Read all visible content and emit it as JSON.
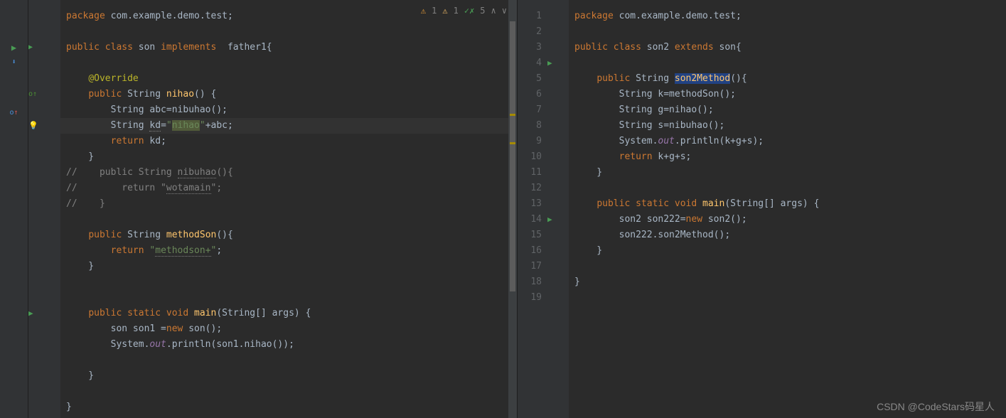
{
  "inspector": {
    "warn": "1",
    "weak": "1",
    "typo": "5"
  },
  "left_editor": {
    "lines": [
      {
        "parts": [
          {
            "t": "package ",
            "c": "kw"
          },
          {
            "t": "com.example.demo.test",
            "c": ""
          },
          {
            "t": ";",
            "c": ""
          }
        ]
      },
      {
        "parts": []
      },
      {
        "parts": [
          {
            "t": "public class ",
            "c": "kw"
          },
          {
            "t": "son ",
            "c": ""
          },
          {
            "t": "implements  ",
            "c": "kw"
          },
          {
            "t": "father1{",
            "c": ""
          }
        ]
      },
      {
        "parts": []
      },
      {
        "parts": [
          {
            "t": "    ",
            "c": ""
          },
          {
            "t": "@Override",
            "c": "ann"
          }
        ]
      },
      {
        "parts": [
          {
            "t": "    ",
            "c": ""
          },
          {
            "t": "public ",
            "c": "kw"
          },
          {
            "t": "String ",
            "c": ""
          },
          {
            "t": "nihao",
            "c": "mtd"
          },
          {
            "t": "() {",
            "c": ""
          }
        ]
      },
      {
        "parts": [
          {
            "t": "        String ",
            "c": ""
          },
          {
            "t": "abc",
            "c": ""
          },
          {
            "t": "=nibuhao();",
            "c": ""
          }
        ]
      },
      {
        "parts": [
          {
            "t": "        String ",
            "c": ""
          },
          {
            "t": "kd",
            "c": "wave"
          },
          {
            "t": "=",
            "c": ""
          },
          {
            "t": "\"",
            "c": "str"
          },
          {
            "t": "nihao",
            "c": "str sel"
          },
          {
            "t": "\"",
            "c": "str"
          },
          {
            "t": "+abc;",
            "c": ""
          }
        ],
        "current": true
      },
      {
        "parts": [
          {
            "t": "        ",
            "c": ""
          },
          {
            "t": "return ",
            "c": "kw"
          },
          {
            "t": "kd",
            "c": ""
          },
          {
            "t": ";",
            "c": ""
          }
        ]
      },
      {
        "parts": [
          {
            "t": "    }",
            "c": ""
          }
        ]
      },
      {
        "parts": [
          {
            "t": "//    public String ",
            "c": "cmt"
          },
          {
            "t": "nibuhao",
            "c": "cmt wave"
          },
          {
            "t": "(){",
            "c": "cmt"
          }
        ]
      },
      {
        "parts": [
          {
            "t": "//        return \"",
            "c": "cmt"
          },
          {
            "t": "wotamain",
            "c": "cmt wave"
          },
          {
            "t": "\";",
            "c": "cmt"
          }
        ]
      },
      {
        "parts": [
          {
            "t": "//    }",
            "c": "cmt"
          }
        ]
      },
      {
        "parts": []
      },
      {
        "parts": [
          {
            "t": "    ",
            "c": ""
          },
          {
            "t": "public ",
            "c": "kw"
          },
          {
            "t": "String ",
            "c": ""
          },
          {
            "t": "methodSon",
            "c": "mtd"
          },
          {
            "t": "(){",
            "c": ""
          }
        ]
      },
      {
        "parts": [
          {
            "t": "        ",
            "c": ""
          },
          {
            "t": "return ",
            "c": "kw"
          },
          {
            "t": "\"",
            "c": "str"
          },
          {
            "t": "methodson+",
            "c": "str wave"
          },
          {
            "t": "\"",
            "c": "str"
          },
          {
            "t": ";",
            "c": ""
          }
        ]
      },
      {
        "parts": [
          {
            "t": "    }",
            "c": ""
          }
        ]
      },
      {
        "parts": []
      },
      {
        "parts": []
      },
      {
        "parts": [
          {
            "t": "    ",
            "c": ""
          },
          {
            "t": "public static void ",
            "c": "kw"
          },
          {
            "t": "main",
            "c": "mtd"
          },
          {
            "t": "(String[] args) {",
            "c": ""
          }
        ]
      },
      {
        "parts": [
          {
            "t": "        son son1 =",
            "c": ""
          },
          {
            "t": "new ",
            "c": "kw"
          },
          {
            "t": "son();",
            "c": ""
          }
        ]
      },
      {
        "parts": [
          {
            "t": "        System.",
            "c": ""
          },
          {
            "t": "out",
            "c": "fld"
          },
          {
            "t": ".println(son1.nihao());",
            "c": ""
          }
        ]
      },
      {
        "parts": []
      },
      {
        "parts": [
          {
            "t": "    }",
            "c": ""
          }
        ]
      },
      {
        "parts": []
      },
      {
        "parts": [
          {
            "t": "}",
            "c": ""
          }
        ]
      }
    ],
    "gutter_icons": {
      "2": {
        "type": "run-down",
        "name": "run-implements-icon"
      },
      "5": {
        "type": "override-up",
        "name": "override-icon"
      },
      "7": {
        "type": "lightbulb",
        "name": "intention-bulb-icon"
      },
      "19": {
        "type": "run",
        "name": "run-icon"
      }
    }
  },
  "right_editor": {
    "lines": [
      {
        "n": 1,
        "parts": [
          {
            "t": "package ",
            "c": "kw"
          },
          {
            "t": "com.example.demo.test;",
            "c": ""
          }
        ]
      },
      {
        "n": 2,
        "parts": []
      },
      {
        "n": 3,
        "parts": [
          {
            "t": "public class ",
            "c": "kw"
          },
          {
            "t": "son2 ",
            "c": ""
          },
          {
            "t": "extends ",
            "c": "kw"
          },
          {
            "t": "son{",
            "c": ""
          }
        ]
      },
      {
        "n": 4,
        "parts": []
      },
      {
        "n": 5,
        "parts": [
          {
            "t": "    ",
            "c": ""
          },
          {
            "t": "public ",
            "c": "kw"
          },
          {
            "t": "String ",
            "c": ""
          },
          {
            "t": "son2Method",
            "c": "mtd highlighted"
          },
          {
            "t": "(){",
            "c": ""
          }
        ]
      },
      {
        "n": 6,
        "parts": [
          {
            "t": "        String k=methodSon();",
            "c": ""
          }
        ]
      },
      {
        "n": 7,
        "parts": [
          {
            "t": "        String g=nihao();",
            "c": ""
          }
        ]
      },
      {
        "n": 8,
        "parts": [
          {
            "t": "        String s=nibuhao();",
            "c": ""
          }
        ]
      },
      {
        "n": 9,
        "parts": [
          {
            "t": "        System.",
            "c": ""
          },
          {
            "t": "out",
            "c": "fld"
          },
          {
            "t": ".println(k+g+s);",
            "c": ""
          }
        ]
      },
      {
        "n": 10,
        "parts": [
          {
            "t": "        ",
            "c": ""
          },
          {
            "t": "return ",
            "c": "kw"
          },
          {
            "t": "k+g+s;",
            "c": ""
          }
        ]
      },
      {
        "n": 11,
        "parts": [
          {
            "t": "    }",
            "c": ""
          }
        ]
      },
      {
        "n": 12,
        "parts": []
      },
      {
        "n": 13,
        "parts": [
          {
            "t": "    ",
            "c": ""
          },
          {
            "t": "public static void ",
            "c": "kw"
          },
          {
            "t": "main",
            "c": "mtd"
          },
          {
            "t": "(String[] args) {",
            "c": ""
          }
        ]
      },
      {
        "n": 14,
        "parts": [
          {
            "t": "        son2 son222=",
            "c": ""
          },
          {
            "t": "new ",
            "c": "kw"
          },
          {
            "t": "son2();",
            "c": ""
          }
        ]
      },
      {
        "n": 15,
        "parts": [
          {
            "t": "        son222.son2Method();",
            "c": ""
          }
        ]
      },
      {
        "n": 16,
        "parts": [
          {
            "t": "    }",
            "c": ""
          }
        ]
      },
      {
        "n": 17,
        "parts": []
      },
      {
        "n": 18,
        "parts": [
          {
            "t": "}",
            "c": ""
          }
        ]
      },
      {
        "n": 19,
        "parts": []
      }
    ],
    "gutter_icons": {
      "3": {
        "type": "run",
        "name": "run-icon"
      },
      "13": {
        "type": "run",
        "name": "run-icon"
      }
    }
  },
  "footer": "CSDN @CodeStars码星人"
}
